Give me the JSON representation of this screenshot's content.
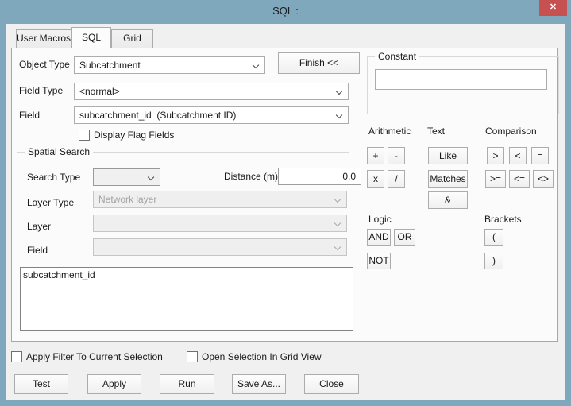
{
  "window": {
    "title": "SQL :",
    "close_glyph": "✕"
  },
  "tabs": [
    {
      "label": "User Macros",
      "active": false
    },
    {
      "label": "SQL",
      "active": true
    },
    {
      "label": "Grid",
      "active": false
    }
  ],
  "form": {
    "object_type": {
      "label": "Object Type",
      "value": "Subcatchment"
    },
    "finish_button": "Finish <<",
    "field_type": {
      "label": "Field Type",
      "value": "<normal>"
    },
    "field": {
      "label": "Field",
      "value": "subcatchment_id  (Subcatchment ID)"
    },
    "display_flag_fields": {
      "label": "Display Flag Fields",
      "checked": false
    }
  },
  "spatial_search": {
    "title": "Spatial Search",
    "search_type": {
      "label": "Search Type",
      "value": ""
    },
    "distance": {
      "label": "Distance (m)",
      "value": "0.0"
    },
    "layer_type": {
      "label": "Layer Type",
      "value": "Network layer",
      "disabled": true
    },
    "layer": {
      "label": "Layer",
      "value": "",
      "disabled": true
    },
    "field": {
      "label": "Field",
      "value": "",
      "disabled": true
    }
  },
  "constant": {
    "title": "Constant",
    "value": ""
  },
  "operators": {
    "arithmetic": {
      "label": "Arithmetic",
      "buttons": [
        "+",
        "-",
        "x",
        "/"
      ]
    },
    "text": {
      "label": "Text",
      "buttons": [
        "Like",
        "Matches",
        "&"
      ]
    },
    "comparison": {
      "label": "Comparison",
      "buttons": [
        ">",
        "<",
        "=",
        ">=",
        "<=",
        "<>"
      ]
    },
    "logic": {
      "label": "Logic",
      "buttons": [
        "AND",
        "OR",
        "NOT"
      ]
    },
    "brackets": {
      "label": "Brackets",
      "buttons": [
        "(",
        ")"
      ]
    }
  },
  "query_editor": {
    "text": "subcatchment_id"
  },
  "options": [
    {
      "label": "Apply Filter To Current Selection",
      "checked": false
    },
    {
      "label": "Open Selection In Grid View",
      "checked": false
    }
  ],
  "action_buttons": [
    {
      "label": "Test"
    },
    {
      "label": "Apply"
    },
    {
      "label": "Run"
    },
    {
      "label": "Save As..."
    },
    {
      "label": "Close"
    }
  ],
  "colors": {
    "frame": "#7fa8bc",
    "close": "#c75050",
    "client": "#f0f0f0",
    "page": "#fbfbfb",
    "border": "#acacac",
    "text": "#1a1a1a",
    "disabled": "#a3a3a3"
  }
}
